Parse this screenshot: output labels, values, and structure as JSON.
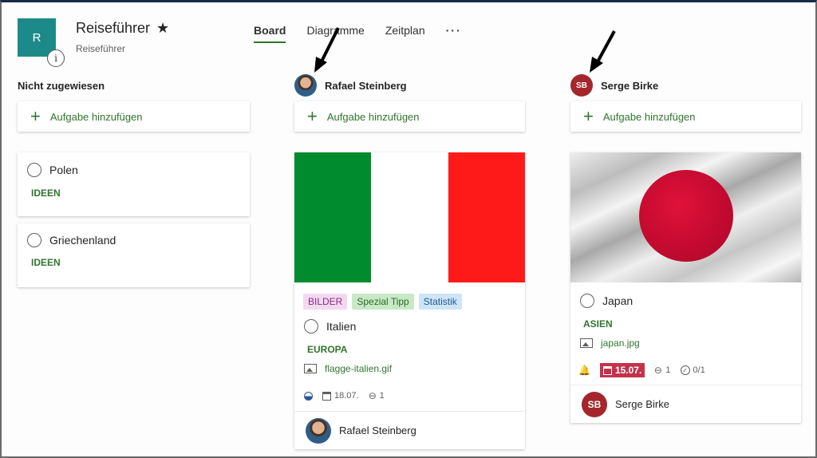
{
  "header": {
    "plan_initial": "R",
    "plan_title": "Reiseführer",
    "plan_subtitle": "Reiseführer",
    "info_glyph": "i",
    "star_glyph": "★",
    "tabs": [
      {
        "label": "Board",
        "active": true
      },
      {
        "label": "Diagramme",
        "active": false
      },
      {
        "label": "Zeitplan",
        "active": false
      }
    ],
    "more_glyph": "···"
  },
  "columns": {
    "unassigned": {
      "title": "Nicht zugewiesen",
      "add_label": "Aufgabe hinzufügen",
      "tasks": [
        {
          "title": "Polen",
          "bucket": "IDEEN"
        },
        {
          "title": "Griechenland",
          "bucket": "IDEEN"
        }
      ]
    },
    "rafael": {
      "title": "Rafael Steinberg",
      "add_label": "Aufgabe hinzufügen",
      "task": {
        "labels": [
          {
            "text": "BILDER",
            "bg": "#f3d9f0",
            "fg": "#8a2d82"
          },
          {
            "text": "Spezial Tipp",
            "bg": "#c9e8c6",
            "fg": "#2c6b26"
          },
          {
            "text": "Statistik",
            "bg": "#cfe4f6",
            "fg": "#1f5a91"
          }
        ],
        "title": "Italien",
        "bucket": "EUROPA",
        "attachment": "flagge-italien.gif",
        "due": "18.07.",
        "attachments_count": "1",
        "assignee": "Rafael Steinberg"
      }
    },
    "serge": {
      "title": "Serge Birke",
      "initials": "SB",
      "add_label": "Aufgabe hinzufügen",
      "task": {
        "title": "Japan",
        "bucket": "ASIEN",
        "attachment": "japan.jpg",
        "due": "15.07.",
        "attachments_count": "1",
        "checklist": "0/1",
        "assignee": "Serge Birke",
        "assignee_initials": "SB"
      }
    }
  },
  "colors": {
    "accent": "#31752f",
    "serge_avatar": "#a4262c",
    "overdue": "#c4314b",
    "plan_tile": "#1d8a8a"
  },
  "icons": [
    "info-icon",
    "star-icon",
    "more-icon",
    "plus-icon",
    "arrow-icon",
    "image-icon",
    "calendar-icon",
    "paperclip-icon",
    "progress-icon",
    "bell-icon",
    "checklist-icon"
  ]
}
